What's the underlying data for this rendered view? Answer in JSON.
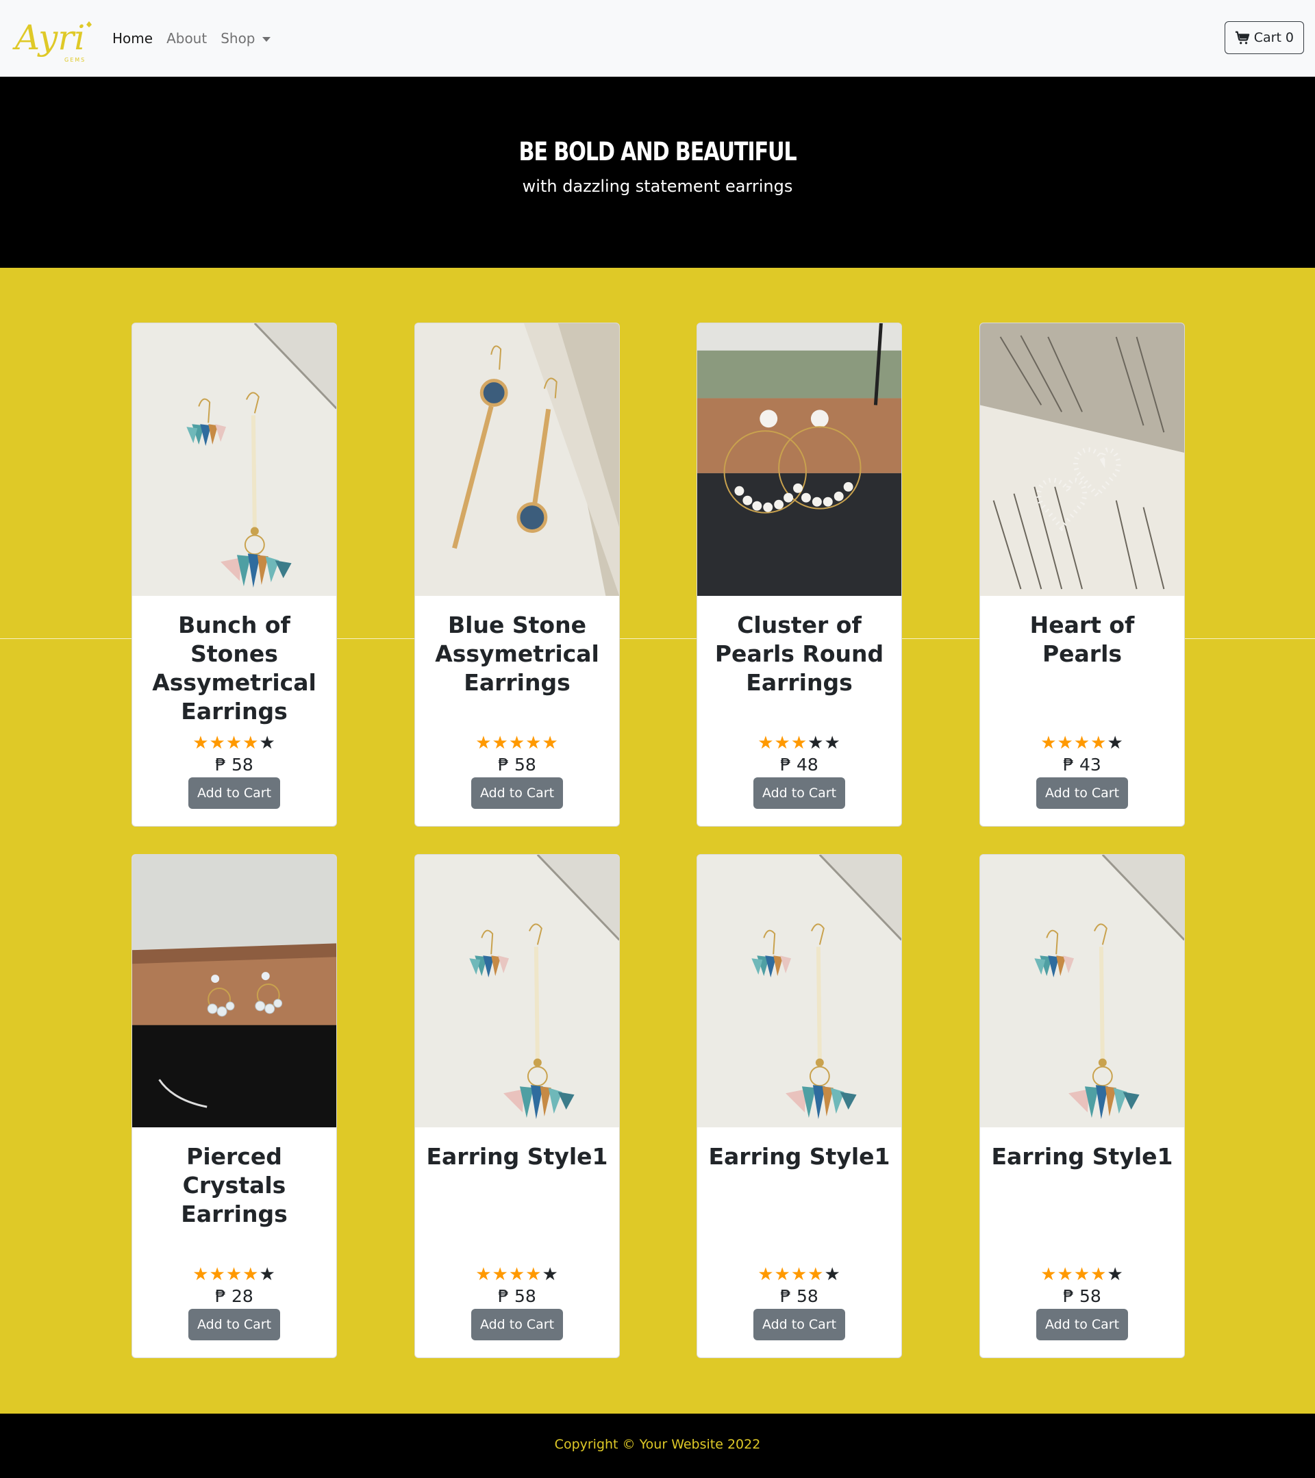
{
  "navbar": {
    "brand": "Ayri",
    "brand_sub": "GEMS",
    "links": [
      {
        "label": "Home"
      },
      {
        "label": "About"
      },
      {
        "label": "Shop"
      }
    ],
    "cart_label": "Cart",
    "cart_count": "0"
  },
  "hero": {
    "title": "BE BOLD AND BEAUTIFUL",
    "subtitle": "with dazzling statement earrings"
  },
  "colors": {
    "accent": "#dfc927",
    "star": "#ff9900",
    "button": "#6c757d"
  },
  "currency": "₱",
  "products": [
    {
      "name": "Bunch of Stones Assymetrical Earrings",
      "rating": 4,
      "price": "58",
      "button": "Add to Cart",
      "image": "tassel-earrings-photo"
    },
    {
      "name": "Blue Stone Assymetrical Earrings",
      "rating": 5,
      "price": "58",
      "button": "Add to Cart",
      "image": "blue-stone-earrings-photo"
    },
    {
      "name": "Cluster of Pearls Round Earrings",
      "rating": 3,
      "price": "48",
      "button": "Add to Cart",
      "image": "pearl-hoop-earrings-photo"
    },
    {
      "name": "Heart of Pearls",
      "rating": 4,
      "price": "43",
      "button": "Add to Cart",
      "image": "heart-pearl-earrings-photo"
    },
    {
      "name": "Pierced Crystals Earrings",
      "rating": 4,
      "price": "28",
      "button": "Add to Cart",
      "image": "crystal-earrings-photo"
    },
    {
      "name": "Earring Style1",
      "rating": 4,
      "price": "58",
      "button": "Add to Cart",
      "image": "tassel-earrings-photo"
    },
    {
      "name": "Earring Style1",
      "rating": 4,
      "price": "58",
      "button": "Add to Cart",
      "image": "tassel-earrings-photo"
    },
    {
      "name": "Earring Style1",
      "rating": 4,
      "price": "58",
      "button": "Add to Cart",
      "image": "tassel-earrings-photo"
    }
  ],
  "footer": {
    "text": "Copyright © Your Website 2022"
  }
}
